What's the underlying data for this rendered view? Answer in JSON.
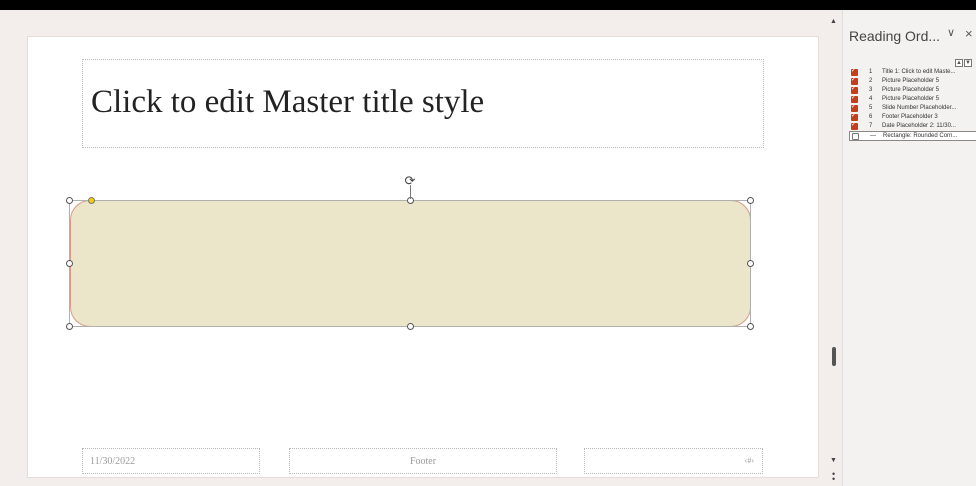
{
  "slide": {
    "title_text": "Click to edit Master title style",
    "date_text": "11/30/2022",
    "footer_text": "Footer",
    "number_text": "‹#›"
  },
  "panel": {
    "title": "Reading Ord...",
    "chevron": "∨",
    "close": "×",
    "items": [
      {
        "num": "1",
        "label": "Title 1: Click to edit Maste...",
        "checked": true
      },
      {
        "num": "2",
        "label": "Picture Placeholder 5",
        "checked": true
      },
      {
        "num": "3",
        "label": "Picture Placeholder 5",
        "checked": true
      },
      {
        "num": "4",
        "label": "Picture Placeholder 5",
        "checked": true
      },
      {
        "num": "5",
        "label": "Slide Number Placeholder...",
        "checked": true
      },
      {
        "num": "6",
        "label": "Footer Placeholder 3",
        "checked": true
      },
      {
        "num": "7",
        "label": "Date Placeholder 2: 11/30...",
        "checked": true
      },
      {
        "num": "—",
        "label": "Rectangle: Rounded Corn...",
        "checked": false
      }
    ]
  },
  "icons": {
    "rotate": "rotate-handle-icon",
    "move_up": "move-up-icon",
    "move_down": "move-down-icon",
    "scroll_up": "scroll-up-arrow-icon",
    "scroll_down": "scroll-down-arrow-icon"
  },
  "colors": {
    "accent": "#c43e1c",
    "shape_fill": "#ebe5c9",
    "shape_outline": "#d99a8c"
  }
}
